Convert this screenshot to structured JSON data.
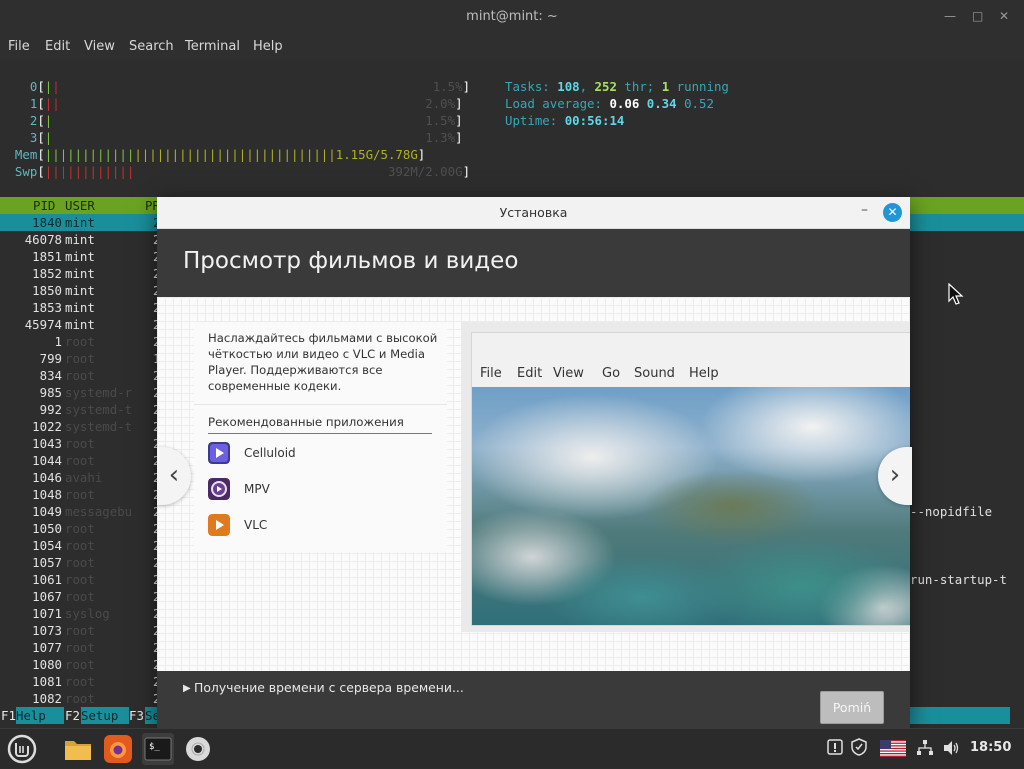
{
  "terminal": {
    "title": "mint@mint: ~",
    "menu": [
      "File",
      "Edit",
      "View",
      "Search",
      "Terminal",
      "Help"
    ],
    "cpus": [
      {
        "id": "0",
        "pct": "1.5%"
      },
      {
        "id": "1",
        "pct": "2.0%"
      },
      {
        "id": "2",
        "pct": "1.5%"
      },
      {
        "id": "3",
        "pct": "1.3%"
      }
    ],
    "mem": {
      "label": "Mem",
      "value": "1.15G/5.78G"
    },
    "swp": {
      "label": "Swp",
      "value": "392M/2.00G"
    },
    "stats": {
      "tasks_label": "Tasks:",
      "tasks": "108",
      "thr": "252",
      "thr_label": "thr;",
      "running": "1",
      "running_label": "running",
      "load_label": "Load average:",
      "load1": "0.06",
      "load5": "0.34",
      "load15": "0.52",
      "uptime_label": "Uptime:",
      "uptime": "00:56:14"
    },
    "header": {
      "pid": "PID",
      "user": "USER",
      "pri": "PR"
    },
    "processes": [
      {
        "pid": "1840",
        "user": "mint",
        "col": "2"
      },
      {
        "pid": "46078",
        "user": "mint",
        "col": "2"
      },
      {
        "pid": "1851",
        "user": "mint",
        "col": "2"
      },
      {
        "pid": "1852",
        "user": "mint",
        "col": "2"
      },
      {
        "pid": "1850",
        "user": "mint",
        "col": "2"
      },
      {
        "pid": "1853",
        "user": "mint",
        "col": "2"
      },
      {
        "pid": "45974",
        "user": "mint",
        "col": "2"
      },
      {
        "pid": "1",
        "user": "root",
        "col": "2"
      },
      {
        "pid": "799",
        "user": "root",
        "col": "1"
      },
      {
        "pid": "834",
        "user": "root",
        "col": "2"
      },
      {
        "pid": "985",
        "user": "systemd-r",
        "col": "2"
      },
      {
        "pid": "992",
        "user": "systemd-t",
        "col": "2"
      },
      {
        "pid": "1022",
        "user": "systemd-t",
        "col": "2"
      },
      {
        "pid": "1043",
        "user": "root",
        "col": "2"
      },
      {
        "pid": "1044",
        "user": "root",
        "col": "2"
      },
      {
        "pid": "1046",
        "user": "avahi",
        "col": "2"
      },
      {
        "pid": "1048",
        "user": "root",
        "col": "2"
      },
      {
        "pid": "1049",
        "user": "messagebu",
        "col": "2"
      },
      {
        "pid": "1050",
        "user": "root",
        "col": "2"
      },
      {
        "pid": "1054",
        "user": "root",
        "col": "2"
      },
      {
        "pid": "1057",
        "user": "root",
        "col": "2"
      },
      {
        "pid": "1061",
        "user": "root",
        "col": "2"
      },
      {
        "pid": "1067",
        "user": "root",
        "col": "2"
      },
      {
        "pid": "1071",
        "user": "syslog",
        "col": "2"
      },
      {
        "pid": "1073",
        "user": "root",
        "col": "2"
      },
      {
        "pid": "1077",
        "user": "root",
        "col": "2"
      },
      {
        "pid": "1080",
        "user": "root",
        "col": "2"
      },
      {
        "pid": "1081",
        "user": "root",
        "col": "2"
      },
      {
        "pid": "1082",
        "user": "root",
        "col": "2"
      }
    ],
    "right_fragments": [
      "--nopidfile",
      "run-startup-t"
    ],
    "fkeys": [
      {
        "key": "F1",
        "label": "Help"
      },
      {
        "key": "F2",
        "label": "Setup"
      },
      {
        "key": "F3",
        "label": "Se"
      }
    ]
  },
  "dialog": {
    "title": "Установка",
    "heading": "Просмотр фильмов и видео",
    "description": "Наслаждайтесь фильмами с высокой чёткостью или видео с VLC и Media Player. Поддерживаются все современные кодеки.",
    "recommended_title": "Рекомендованные приложения",
    "apps": [
      {
        "name": "Celluloid",
        "color": "#5b4bbf"
      },
      {
        "name": "MPV",
        "color": "#6b3f8e"
      },
      {
        "name": "VLC",
        "color": "#e07a1f"
      }
    ],
    "preview_menu": [
      "File",
      "Edit",
      "View",
      "Go",
      "Sound",
      "Help"
    ],
    "prev_icon": "‹",
    "next_icon": "›",
    "footer_status": "Получение времени с сервера времени...",
    "skip_label": "Pomiń"
  },
  "taskbar": {
    "clock": "18:50"
  },
  "colors": {
    "accent": "#2196d6",
    "htop_green": "#6aa321",
    "htop_cyan": "#1a8f9c"
  }
}
